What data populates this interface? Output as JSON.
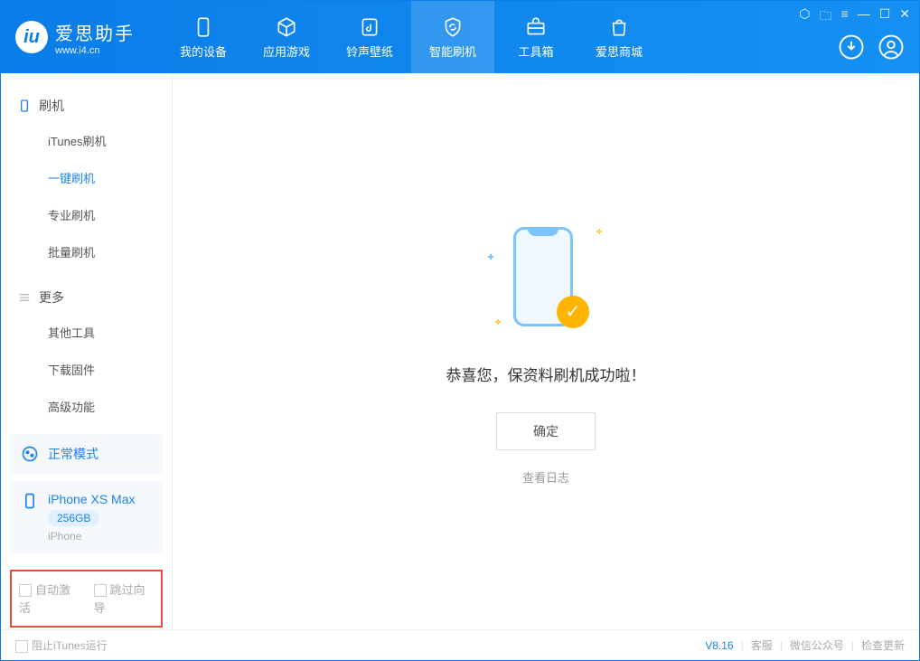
{
  "header": {
    "logo_title": "爱思助手",
    "logo_url": "www.i4.cn",
    "tabs": [
      "我的设备",
      "应用游戏",
      "铃声壁纸",
      "智能刷机",
      "工具箱",
      "爱思商城"
    ],
    "active_tab_index": 3
  },
  "sidebar": {
    "sections": [
      {
        "title": "刷机",
        "items": [
          "iTunes刷机",
          "一键刷机",
          "专业刷机",
          "批量刷机"
        ],
        "active_index": 1
      },
      {
        "title": "更多",
        "items": [
          "其他工具",
          "下载固件",
          "高级功能"
        ],
        "active_index": -1
      }
    ],
    "mode_box": {
      "label": "正常模式"
    },
    "device_box": {
      "name": "iPhone XS Max",
      "storage": "256GB",
      "type": "iPhone"
    },
    "checkboxes": {
      "auto_activate": "自动激活",
      "skip_guide": "跳过向导"
    }
  },
  "main": {
    "success_text": "恭喜您，保资料刷机成功啦！",
    "ok_button": "确定",
    "log_link": "查看日志"
  },
  "footer": {
    "block_itunes": "阻止iTunes运行",
    "version": "V8.16",
    "links": [
      "客服",
      "微信公众号",
      "检查更新"
    ]
  }
}
